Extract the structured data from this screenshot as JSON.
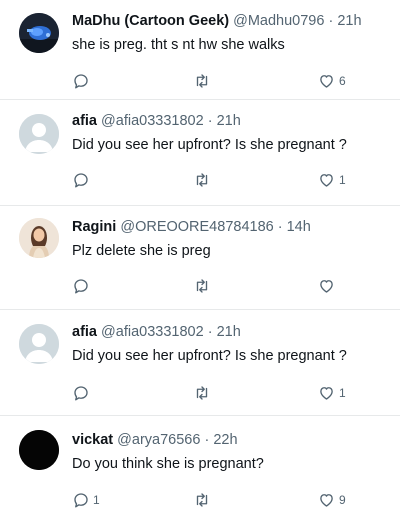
{
  "colors": {
    "text": "#0f1419",
    "secondary": "#536471",
    "divider": "#e7e9ea",
    "default_avatar_bg": "#cfd9de",
    "default_avatar_fg": "#ffffff"
  },
  "tweets": [
    {
      "name": "MaDhu (Cartoon Geek)",
      "handle": "@Madhu0796",
      "sep": "·",
      "time": "21h",
      "text": "she is preg. tht s nt hw she walks",
      "replies": "",
      "retweets": "",
      "likes": "6",
      "avatar": "cartoon-avatar"
    },
    {
      "name": "afia",
      "handle": "@afia03331802",
      "sep": "·",
      "time": "21h",
      "text": "Did you see her upfront? Is she pregnant ?",
      "replies": "",
      "retweets": "",
      "likes": "1",
      "avatar": "default-avatar"
    },
    {
      "name": "Ragini",
      "handle": "@OREOORE48784186",
      "sep": "·",
      "time": "14h",
      "text": "Plz delete she is preg",
      "replies": "",
      "retweets": "",
      "likes": "",
      "avatar": "photo-avatar"
    },
    {
      "name": "afia",
      "handle": "@afia03331802",
      "sep": "·",
      "time": "21h",
      "text": "Did you see her upfront? Is she pregnant ?",
      "replies": "",
      "retweets": "",
      "likes": "1",
      "avatar": "default-avatar"
    },
    {
      "name": "vickat",
      "handle": "@arya76566",
      "sep": "·",
      "time": "22h",
      "text": "Do you think she is pregnant?",
      "replies": "1",
      "retweets": "",
      "likes": "9",
      "avatar": "black-avatar"
    }
  ],
  "icons": {
    "reply": "reply-icon",
    "retweet": "retweet-icon",
    "like": "heart-icon"
  }
}
